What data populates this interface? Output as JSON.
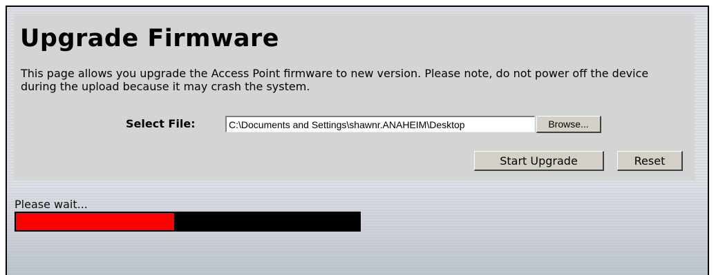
{
  "page": {
    "title": "Upgrade Firmware",
    "description": "This page allows you upgrade the Access Point firmware to new version. Please note, do not power off the device during the upload because it may crash the system."
  },
  "form": {
    "select_file_label": "Select File:",
    "file_value": "C:\\Documents and Settings\\shawnr.ANAHEIM\\Desktop",
    "browse_label": "Browse...",
    "start_upgrade_label": "Start Upgrade",
    "reset_label": "Reset"
  },
  "progress": {
    "status_text": "Please wait...",
    "fraction": 0.46,
    "fill_color": "#ff0000",
    "track_color": "#000000"
  },
  "colors": {
    "panel_background": "#d4d4d4",
    "page_background": "#dcdfe4"
  }
}
